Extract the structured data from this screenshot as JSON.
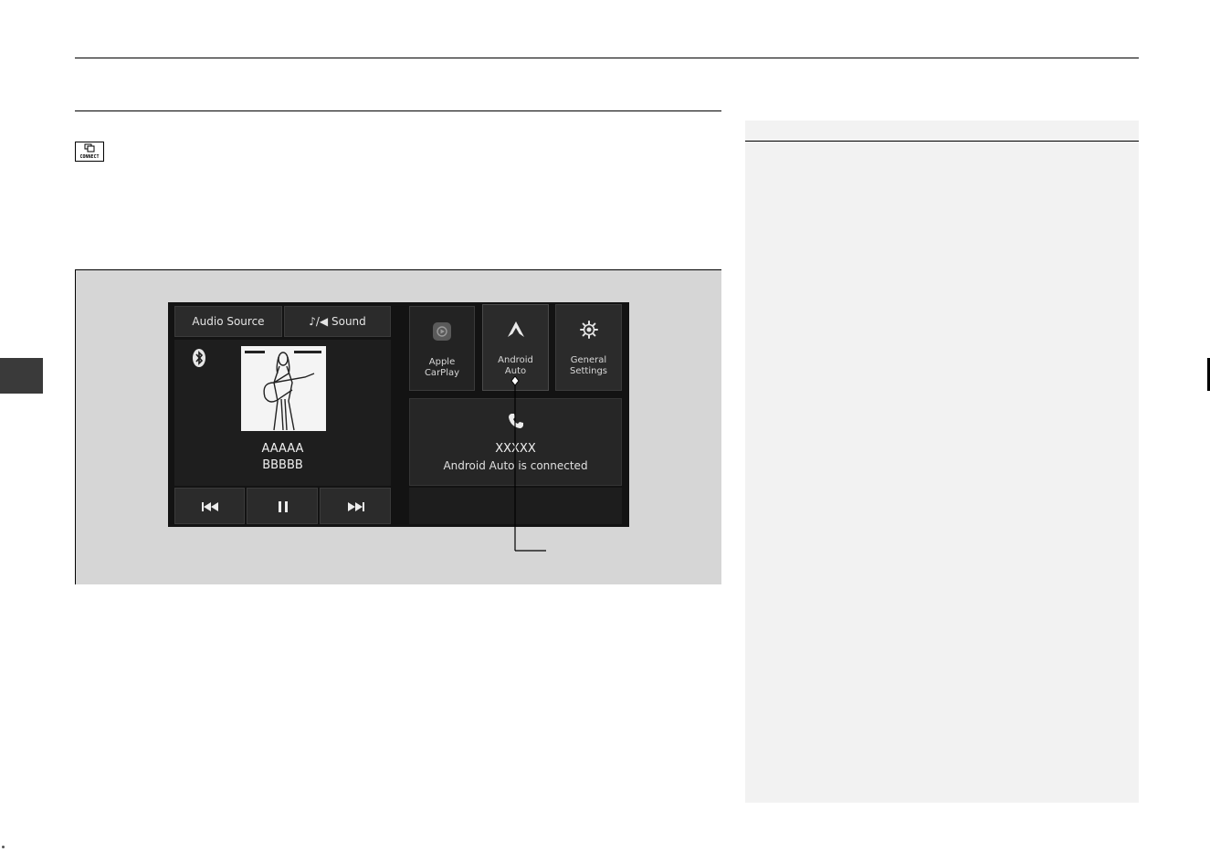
{
  "header": {
    "title": ""
  },
  "badge": {
    "connect_label": "CONNECT"
  },
  "screen": {
    "tabs": [
      {
        "label": "Audio Source"
      },
      {
        "label": "♪/◀ Sound"
      }
    ],
    "apps": [
      {
        "label": "Apple\nCarPlay",
        "icon": "carplay-icon"
      },
      {
        "label": "Android\nAuto",
        "icon": "android-auto-icon"
      },
      {
        "label": "General\nSettings",
        "icon": "gear-icon"
      }
    ],
    "media": {
      "title": "AAAAA",
      "artist": "BBBBB",
      "source_icon": "bluetooth-icon",
      "controls": [
        "previous-track-icon",
        "pause-icon",
        "next-track-icon"
      ]
    },
    "phone": {
      "icon": "phone-icon",
      "device": "XXXXX",
      "status": "Android Auto is connected"
    }
  },
  "colors": {
    "screen_bg": "#131313",
    "tile_bg": "#2b2b2b",
    "figure_bg": "#d6d6d6",
    "note_bg": "#f2f2f2",
    "side_tab": "#3a3a3a"
  }
}
